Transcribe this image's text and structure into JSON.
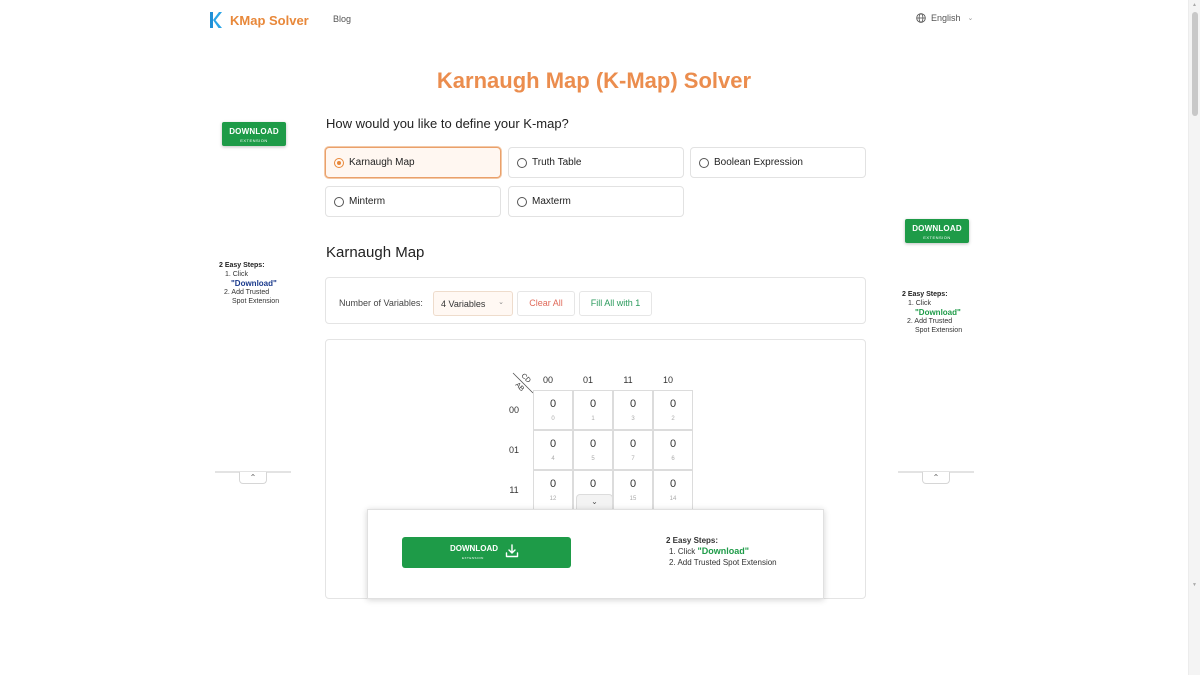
{
  "header": {
    "brand": "KMap Solver",
    "nav_blog": "Blog",
    "language": "English"
  },
  "page_title": "Karnaugh Map (K-Map) Solver",
  "question": "How would you like to define your K-map?",
  "options": [
    {
      "label": "Karnaugh Map",
      "selected": true
    },
    {
      "label": "Truth Table",
      "selected": false
    },
    {
      "label": "Boolean Expression",
      "selected": false
    },
    {
      "label": "Minterm",
      "selected": false
    },
    {
      "label": "Maxterm",
      "selected": false
    }
  ],
  "section_title": "Karnaugh Map",
  "controls": {
    "variables_label": "Number of Variables:",
    "variables_value": "4 Variables",
    "clear_all": "Clear All",
    "fill_all": "Fill All with 1"
  },
  "kmap": {
    "corner_top": "CD",
    "corner_bottom": "AB",
    "col_headers": [
      "00",
      "01",
      "11",
      "10"
    ],
    "row_headers": [
      "00",
      "01",
      "11"
    ],
    "rows": [
      [
        {
          "value": "0",
          "index": "0"
        },
        {
          "value": "0",
          "index": "1"
        },
        {
          "value": "0",
          "index": "3"
        },
        {
          "value": "0",
          "index": "2"
        }
      ],
      [
        {
          "value": "0",
          "index": "4"
        },
        {
          "value": "0",
          "index": "5"
        },
        {
          "value": "0",
          "index": "7"
        },
        {
          "value": "0",
          "index": "6"
        }
      ],
      [
        {
          "value": "0",
          "index": "12"
        },
        {
          "value": "0",
          "index": ""
        },
        {
          "value": "0",
          "index": "15"
        },
        {
          "value": "0",
          "index": "14"
        }
      ]
    ]
  },
  "ads": {
    "download": "DOWNLOAD",
    "extension": "EXTENSION",
    "steps_title": "2 Easy Steps:",
    "step1_prefix": "1. Click",
    "step1_download": "\"Download\"",
    "step2_left": "2. Add Trusted",
    "step2_right": "Spot Extension",
    "step2_full": "2. Add Trusted Spot Extension"
  },
  "colors": {
    "brand_orange": "#e8883a",
    "ad_green": "#1e9b48",
    "clear_red": "#e06a5a",
    "fill_green": "#2b9a5c"
  },
  "icons": {
    "language": "globe-icon",
    "dropdown": "chevron-down-icon",
    "scroll_up": "chevron-up-icon",
    "download": "download-icon"
  }
}
